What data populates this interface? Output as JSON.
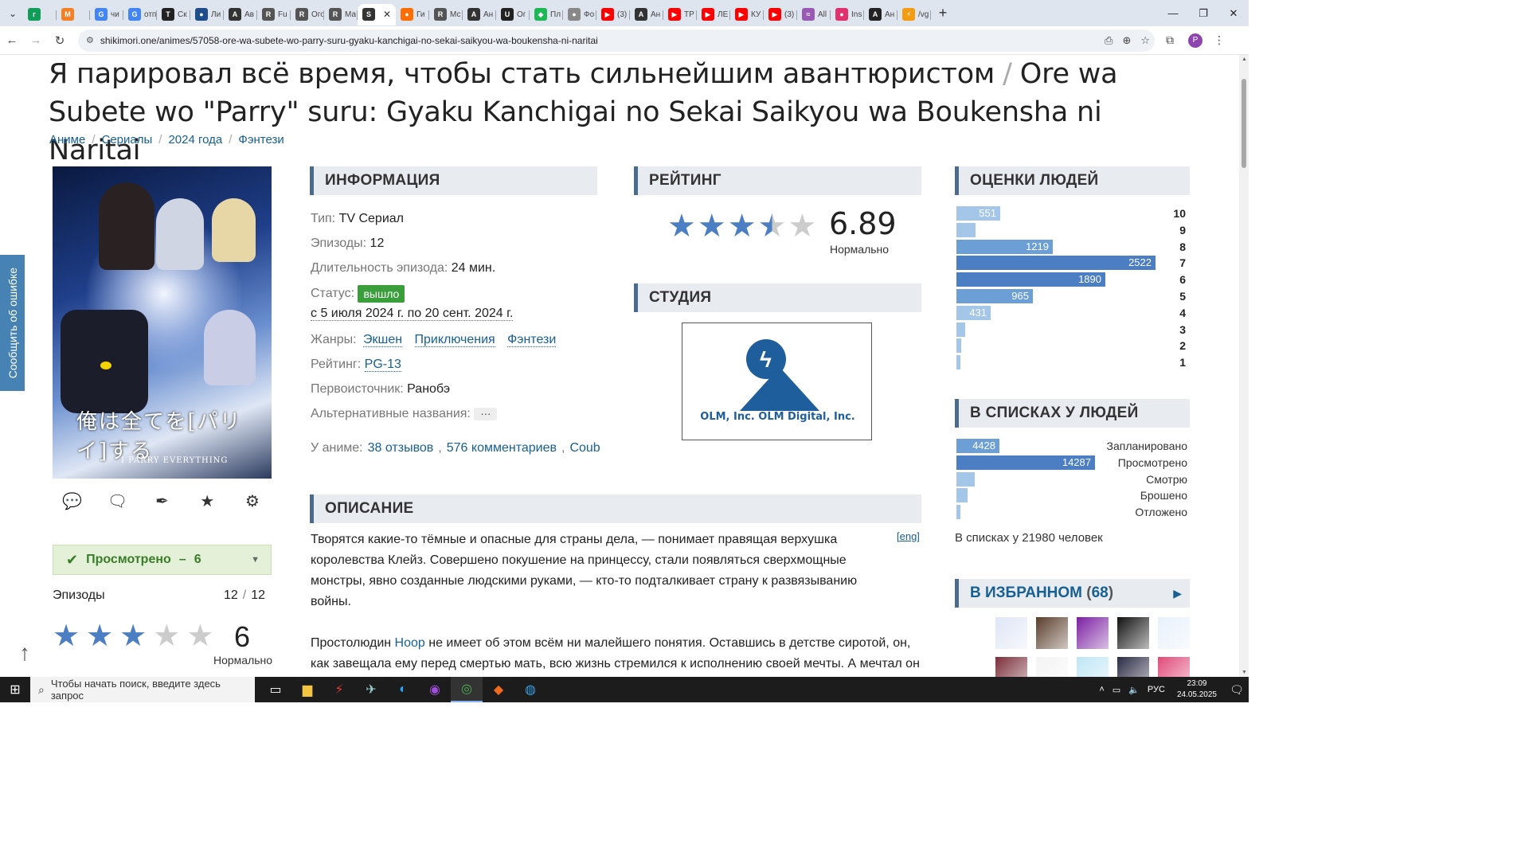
{
  "browser": {
    "tabs": [
      {
        "label": "",
        "icon_text": "г",
        "color": "#0f9d58"
      },
      {
        "label": "",
        "icon_text": "M",
        "color": "#f47f24"
      },
      {
        "label": "чи",
        "icon_text": "G",
        "color": "#4285f4"
      },
      {
        "label": "отп",
        "icon_text": "G",
        "color": "#4285f4"
      },
      {
        "label": "Ск",
        "icon_text": "T",
        "color": "#222222"
      },
      {
        "label": "Ли",
        "icon_text": "●",
        "color": "#1e4e8c"
      },
      {
        "label": "Ав",
        "icon_text": "A",
        "color": "#333333"
      },
      {
        "label": "Fu",
        "icon_text": "R",
        "color": "#555555"
      },
      {
        "label": "Ого",
        "icon_text": "R",
        "color": "#555555"
      },
      {
        "label": "Ма",
        "icon_text": "R",
        "color": "#555555"
      },
      {
        "label": "",
        "icon_text": "S",
        "color": "#333333",
        "active": true
      },
      {
        "label": "Ги",
        "icon_text": "●",
        "color": "#ff6d00"
      },
      {
        "label": "Мс",
        "icon_text": "R",
        "color": "#555555"
      },
      {
        "label": "Ан",
        "icon_text": "A",
        "color": "#333333"
      },
      {
        "label": "Ог",
        "icon_text": "U",
        "color": "#222222"
      },
      {
        "label": "Пл",
        "icon_text": "◆",
        "color": "#1db954"
      },
      {
        "label": "Фо",
        "icon_text": "●",
        "color": "#888888"
      },
      {
        "label": "(3)",
        "icon_text": "▶",
        "color": "#ff0000"
      },
      {
        "label": "Ан",
        "icon_text": "A",
        "color": "#333333"
      },
      {
        "label": "ТР",
        "icon_text": "▶",
        "color": "#ff0000"
      },
      {
        "label": "ЛЕ",
        "icon_text": "▶",
        "color": "#ff0000"
      },
      {
        "label": "КУ",
        "icon_text": "▶",
        "color": "#ff0000"
      },
      {
        "label": "(3)",
        "icon_text": "▶",
        "color": "#ff0000"
      },
      {
        "label": "All",
        "icon_text": "≈",
        "color": "#9b59b6"
      },
      {
        "label": "Ins",
        "icon_text": "●",
        "color": "#e1306c"
      },
      {
        "label": "Ан",
        "icon_text": "A",
        "color": "#222222"
      },
      {
        "label": "/vg",
        "icon_text": "⚡",
        "color": "#f39c12"
      }
    ],
    "url": "shikimori.one/animes/57058-ore-wa-subete-wo-parry-suru-gyaku-kanchigai-no-sekai-saikyou-wa-boukensha-ni-naritai",
    "profile_initial": "P"
  },
  "anime": {
    "title_ru": "Я парировал всё время, чтобы стать сильнейшим авантюристом",
    "title_sep": "/",
    "title_en": "Ore wa Subete wo \"Parry\" suru: Gyaku Kanchigai no Sekai Saikyou wa Boukensha ni Naritai",
    "breadcrumbs": [
      "Аниме",
      "Сериалы",
      "2024 года",
      "Фэнтези"
    ],
    "report_label": "Сообщить об ошибке",
    "poster": {
      "jp_title": "俺は全てを[パリイ]する",
      "en_title": "I PARRY EVERYTHING"
    }
  },
  "info": {
    "header": "ИНФОРМАЦИЯ",
    "type_k": "Тип:",
    "type_v": "TV Сериал",
    "episodes_k": "Эпизоды:",
    "episodes_v": "12",
    "duration_k": "Длительность эпизода:",
    "duration_v": "24 мин.",
    "status_k": "Статус:",
    "status_v": "вышло",
    "dates": "с 5 июля 2024 г. по 20 сент. 2024 г.",
    "genres_k": "Жанры:",
    "genres": [
      "Экшен",
      "Приключения",
      "Фэнтези"
    ],
    "rating_k": "Рейтинг:",
    "rating_v": "PG-13",
    "source_k": "Первоисточник:",
    "source_v": "Ранобэ",
    "alt_k": "Альтернативные названия:",
    "alt_v": "···",
    "about_k": "У аниме:",
    "reviews": "38 отзывов",
    "comments": "576 комментариев",
    "coub": "Coub"
  },
  "rating": {
    "header": "РЕЙТИНГ",
    "score": "6.89",
    "score_value": 6.89,
    "label": "Нормально"
  },
  "studio": {
    "header": "СТУДИЯ",
    "logo_text": "OLM, Inc.  OLM Digital, Inc."
  },
  "description": {
    "header": "ОПИСАНИЕ",
    "eng_link": "[eng]",
    "p1": "Творятся какие-то тёмные и опасные для страны дела, — понимает правящая верхушка королевства Клейз. Совершено покушение на принцессу, стали появляться сверхмощные монстры, явно созданные людскими руками, — кто-то подталкивает страну к развязыванию войны.",
    "p2_before": "Простолюдин ",
    "p2_link": "Ноор",
    "p2_after": " не имеет об этом всём ни малейшего понятия. Оставшись в детстве сиротой, он, как завещала ему перед смертью мать, всю жизнь стремился к исполнению своей мечты. А мечтал он о том, чтобы стать авантюристом. К сожалению, он в этом не преуспел. Как оказалось, у него нет ни"
  },
  "user": {
    "status": "Просмотрено",
    "status_dash": "–",
    "status_score": "6",
    "episodes_label": "Эпизоды",
    "episodes_watched": "12",
    "episodes_sep": "/",
    "episodes_total": "12",
    "score": "6",
    "score_stars": 3,
    "score_label": "Нормально"
  },
  "scores": {
    "header": "ОЦЕНКИ ЛЮДЕЙ",
    "rows": [
      {
        "label": "10",
        "value": 551,
        "text": "551"
      },
      {
        "label": "9",
        "value": 240,
        "text": ""
      },
      {
        "label": "8",
        "value": 1219,
        "text": "1219"
      },
      {
        "label": "7",
        "value": 2522,
        "text": "2522"
      },
      {
        "label": "6",
        "value": 1890,
        "text": "1890"
      },
      {
        "label": "5",
        "value": 965,
        "text": "965"
      },
      {
        "label": "4",
        "value": 431,
        "text": "431"
      },
      {
        "label": "3",
        "value": 110,
        "text": ""
      },
      {
        "label": "2",
        "value": 60,
        "text": ""
      },
      {
        "label": "1",
        "value": 55,
        "text": ""
      }
    ],
    "max": 2522
  },
  "lists": {
    "header": "В СПИСКАХ У ЛЮДЕЙ",
    "rows": [
      {
        "label": "Запланировано",
        "value": 4428,
        "text": "4428"
      },
      {
        "label": "Просмотрено",
        "value": 14287,
        "text": "14287"
      },
      {
        "label": "Смотрю",
        "value": 1900,
        "text": ""
      },
      {
        "label": "Брошено",
        "value": 1150,
        "text": ""
      },
      {
        "label": "Отложено",
        "value": 200,
        "text": ""
      }
    ],
    "max": 14287,
    "total": "В списках у 21980 человек"
  },
  "favorites": {
    "header": "В ИЗБРАННОМ",
    "count": "68",
    "avatar_colors": [
      "#dfe6f5",
      "#5a3d2b",
      "#7b1fa2",
      "#111111",
      "#e8f1fb",
      "#7b2e3a",
      "#f4f4f4",
      "#bfe6f5",
      "#2a2a44",
      "#e04a79",
      "#cfcfcf"
    ]
  },
  "taskbar": {
    "search_placeholder": "Чтобы начать поиск, введите здесь запрос",
    "lang": "РУС",
    "time": "23:09",
    "date": "24.05.2025"
  }
}
